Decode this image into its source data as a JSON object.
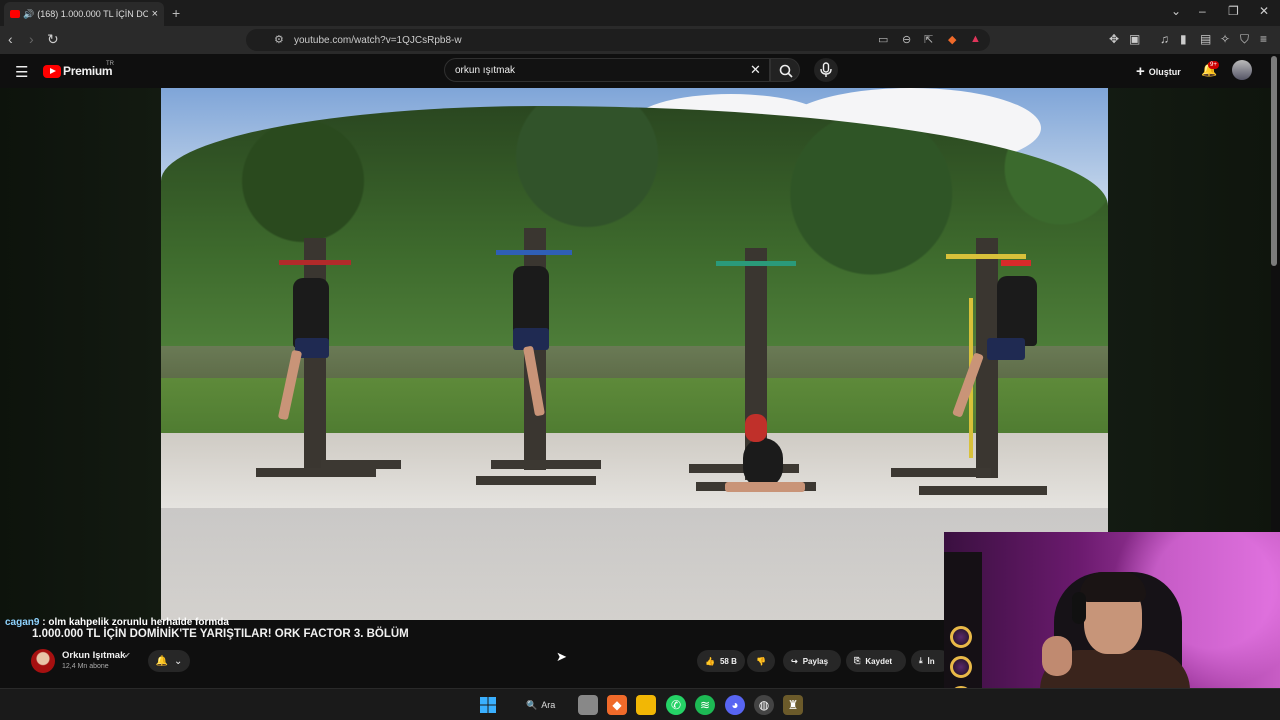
{
  "browser": {
    "tab_title": "(168) 1.000.000 TL İÇİN DOMİ",
    "url": "youtube.com/watch?v=1QJCsRpb8-w"
  },
  "youtube": {
    "logo_text": "Premium",
    "logo_region": "TR",
    "search_query": "orkun ışıtmak",
    "create_label": "Oluştur",
    "notification_count": "9+"
  },
  "chat": {
    "user": "cagan9",
    "message": " : olm kahpelik zorunlu herhalde formda"
  },
  "video": {
    "title": "1.000.000 TL İÇİN DOMİNİK'TE YARIŞTILAR! ORK FACTOR 3. BÖLÜM",
    "channel_name": "Orkun Işıtmak",
    "subscribers": "12,4 Mn abone",
    "likes": "58 B",
    "share_label": "Paylaş",
    "save_label": "Kaydet",
    "download_label": "İn"
  },
  "taskbar": {
    "search_label": "Ara"
  },
  "colors": {
    "brand": "#ff0000",
    "background": "#0f0f0f"
  }
}
